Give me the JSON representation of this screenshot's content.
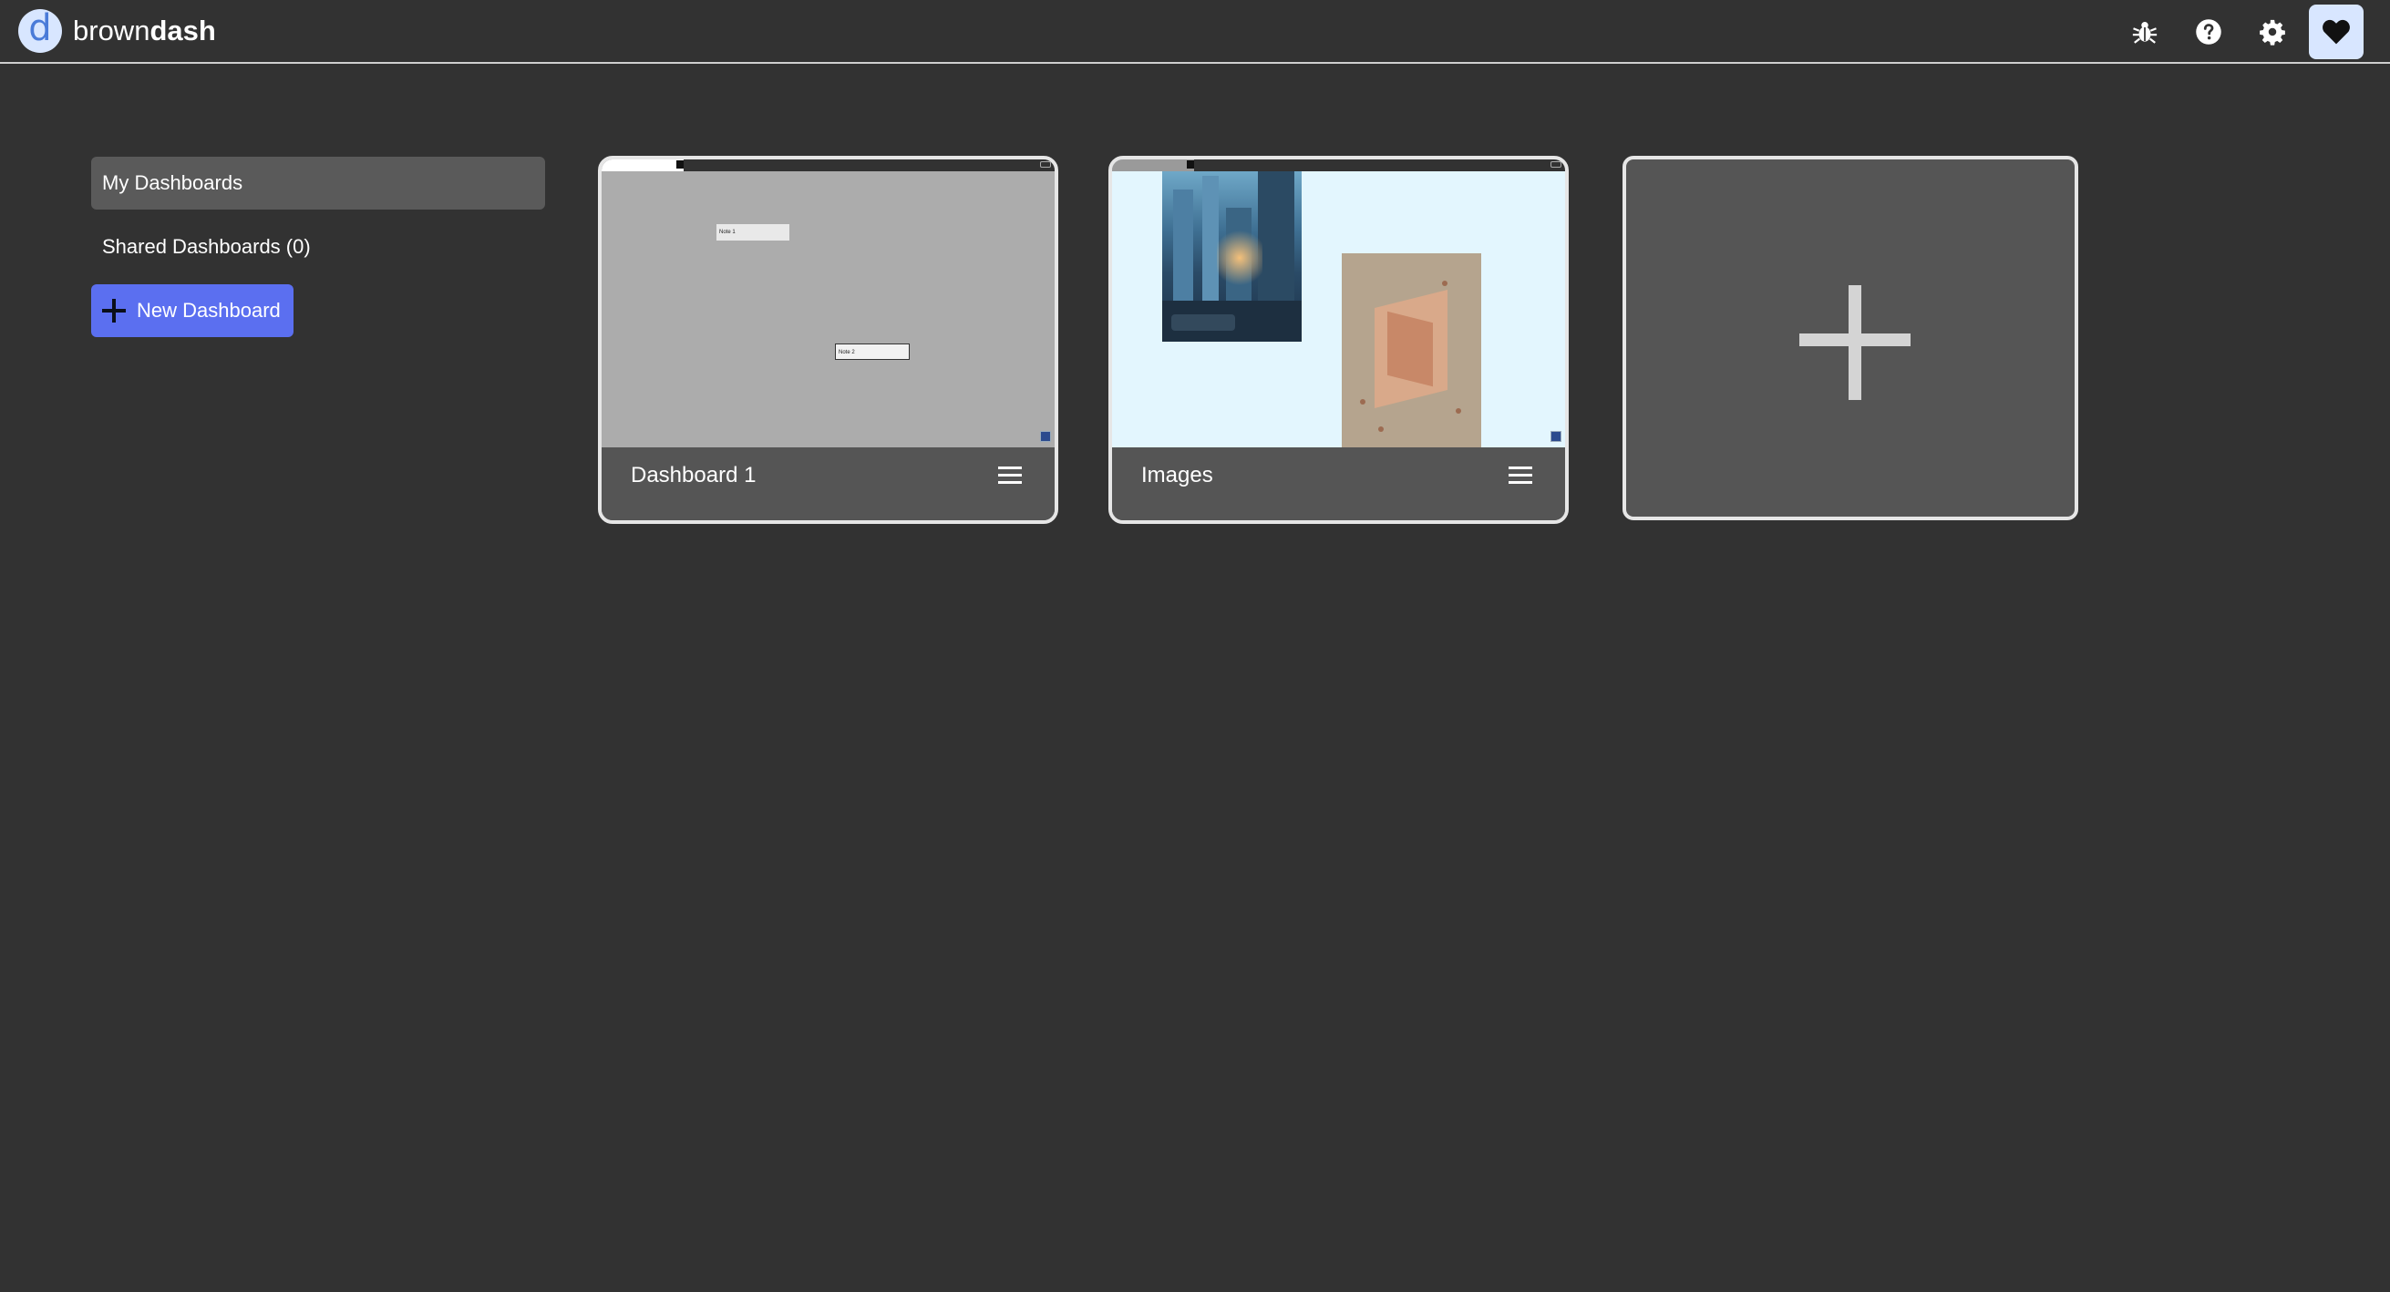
{
  "app": {
    "logo_letter": "d",
    "name_part1": "brown",
    "name_part2": "dash"
  },
  "topbar": {
    "icons": [
      "bug-icon",
      "help-icon",
      "gear-icon",
      "heart-icon"
    ],
    "heart_bg": "#d8e6ff"
  },
  "sidebar": {
    "items": [
      {
        "label": "My Dashboards",
        "active": true
      },
      {
        "label": "Shared Dashboards (0)",
        "active": false
      }
    ],
    "new_button_label": "New Dashboard",
    "new_button_color": "#5b6ff0"
  },
  "dashboards": [
    {
      "title": "Dashboard 1",
      "preview_bg": "#acacac",
      "notes": [
        "Note 1",
        "Note 2"
      ]
    },
    {
      "title": "Images",
      "preview_bg": "#e3f6fe"
    }
  ],
  "add_card": {
    "icon": "plus-icon"
  },
  "colors": {
    "background": "#323232",
    "card": "#555555",
    "card_border": "#e6e6e6"
  }
}
